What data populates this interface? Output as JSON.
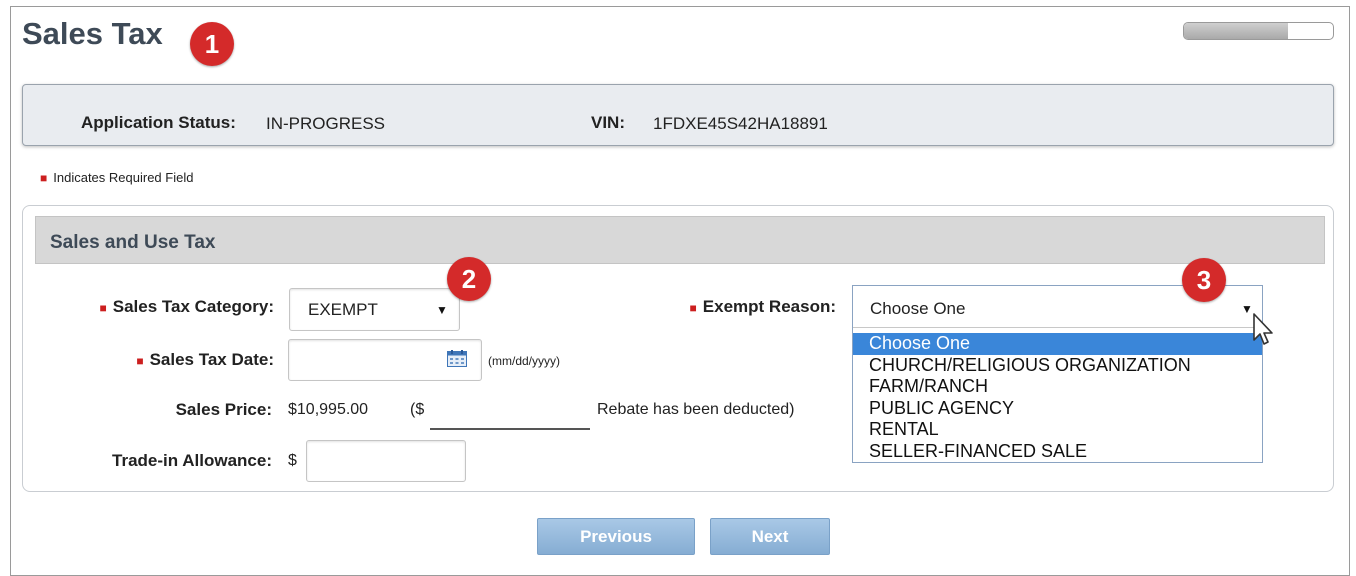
{
  "page": {
    "title": "Sales Tax",
    "progress_fraction": 0.7
  },
  "callouts": [
    "1",
    "2",
    "3"
  ],
  "status": {
    "app_status_label": "Application Status:",
    "app_status_value": "IN-PROGRESS",
    "vin_label": "VIN:",
    "vin_value": "1FDXE45S42HA18891"
  },
  "required_note": "Indicates Required Field",
  "section": {
    "title": "Sales and Use Tax"
  },
  "form": {
    "category_label": "Sales Tax Category:",
    "category_value": "EXEMPT",
    "date_label": "Sales Tax Date:",
    "date_value": "",
    "date_hint": "(mm/dd/yyyy)",
    "price_label": "Sales Price:",
    "price_value": "$10,995.00",
    "rebate_prefix": "($",
    "rebate_suffix": "Rebate has been deducted)",
    "trade_label": "Trade-in Allowance:",
    "trade_prefix": "$",
    "trade_value": "",
    "exempt_label": "Exempt Reason:",
    "exempt_value": "Choose One",
    "exempt_options": [
      "Choose One",
      "CHURCH/RELIGIOUS ORGANIZATION",
      "FARM/RANCH",
      "PUBLIC AGENCY",
      "RENTAL",
      "SELLER-FINANCED SALE"
    ]
  },
  "buttons": {
    "previous": "Previous",
    "next": "Next"
  },
  "colors": {
    "callout": "#d42a2a",
    "selected_option": "#3a86d9",
    "button": "#97bbe0",
    "required": "#cc1f1f"
  },
  "icons": [
    "calendar-icon",
    "dropdown-arrow-icon",
    "mouse-cursor-icon",
    "required-asterisk-icon"
  ]
}
